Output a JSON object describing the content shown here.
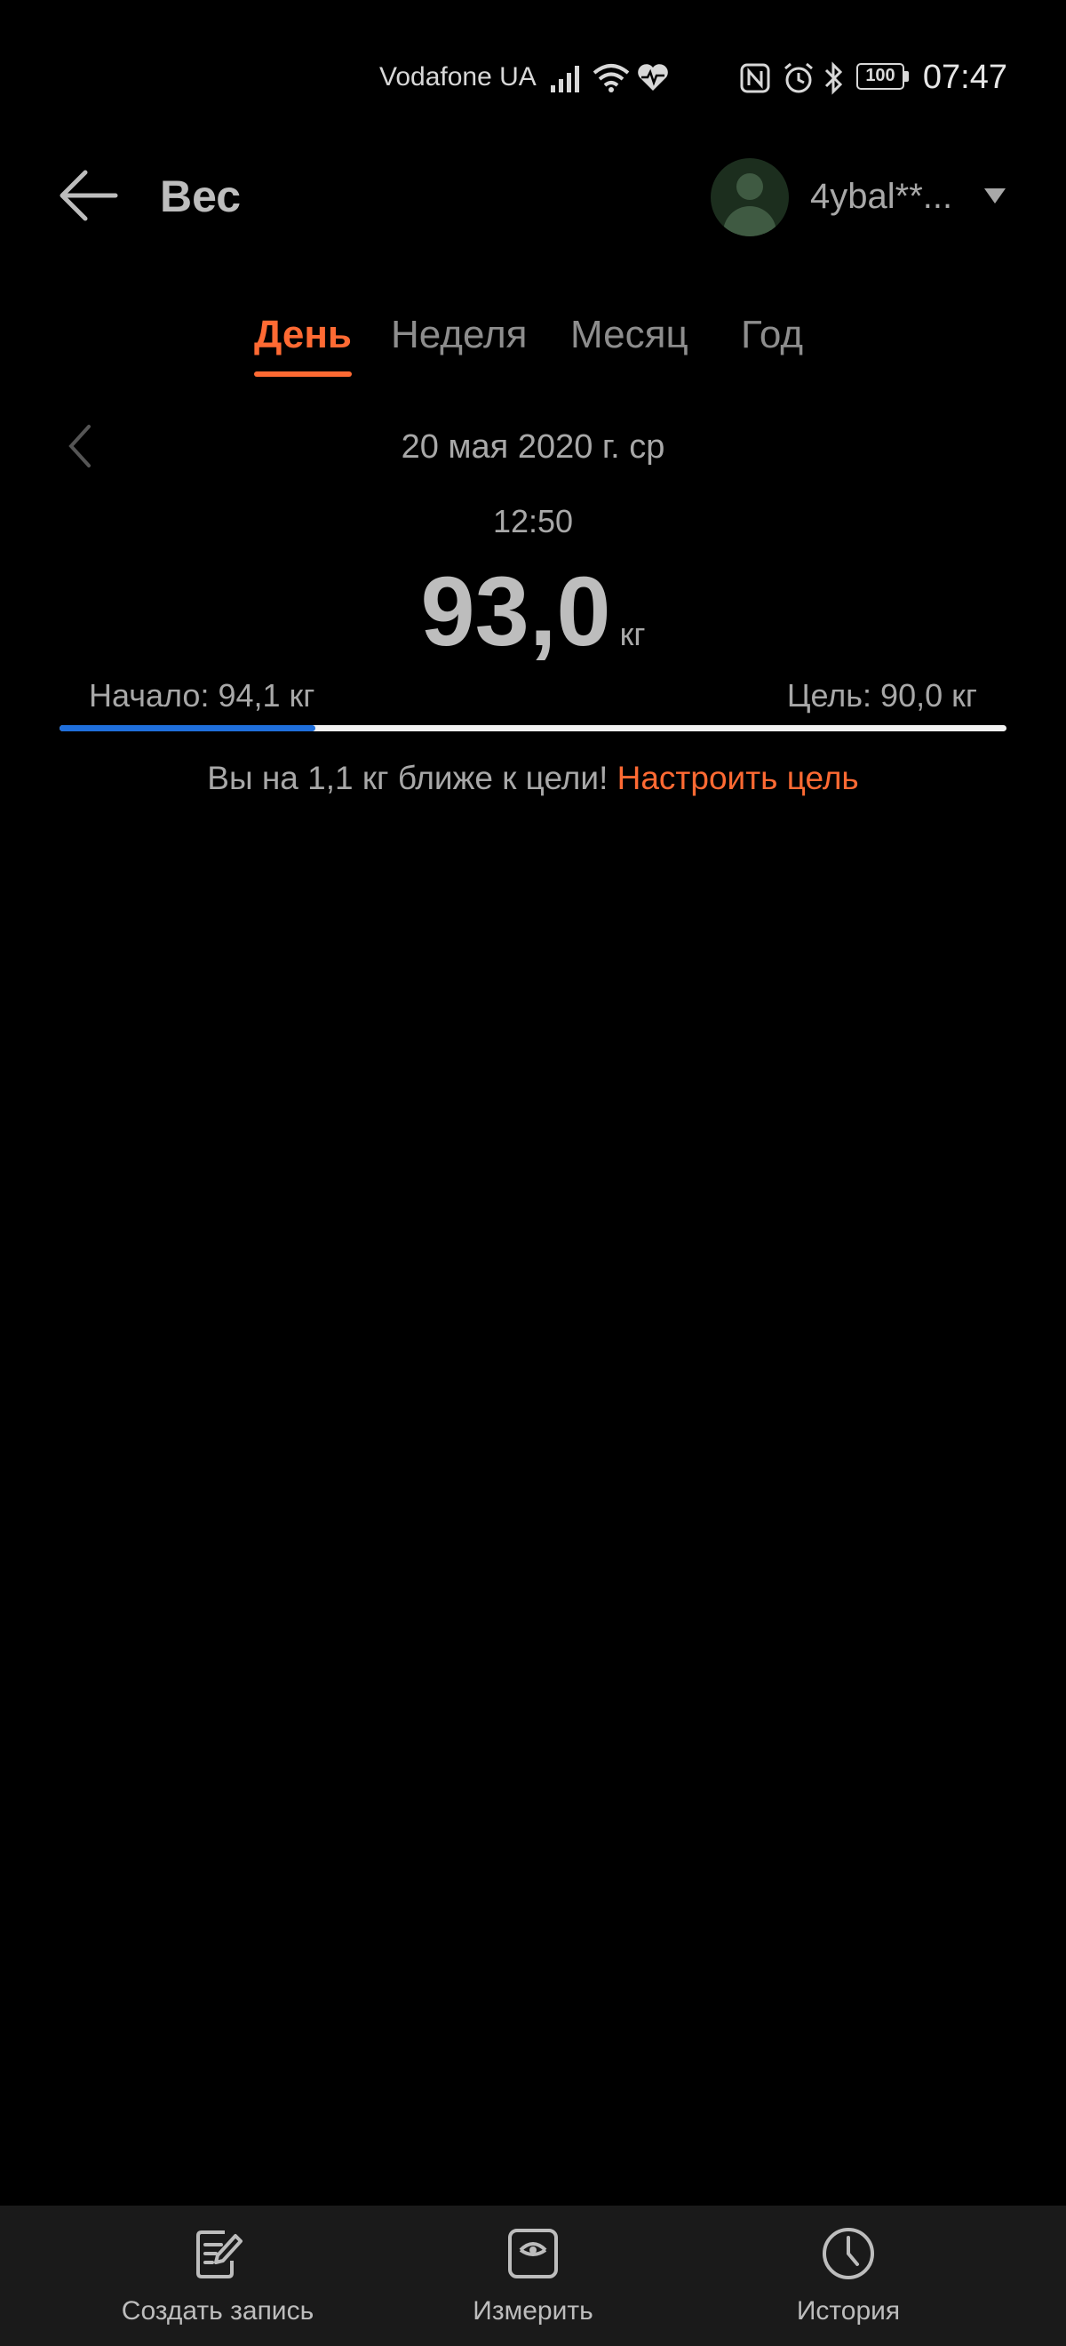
{
  "status_bar": {
    "carrier": "Vodafone UA",
    "battery": "100",
    "time": "07:47"
  },
  "header": {
    "title": "Вес",
    "account_name": "4ybal**..."
  },
  "tabs": [
    {
      "label": "День",
      "active": true
    },
    {
      "label": "Неделя",
      "active": false
    },
    {
      "label": "Месяц",
      "active": false
    },
    {
      "label": "Год",
      "active": false
    }
  ],
  "reading": {
    "date": "20 мая 2020 г. ср",
    "time": "12:50",
    "value": "93,0",
    "unit": "кг"
  },
  "goal": {
    "start_label": "Начало: 94,1 кг",
    "goal_label": "Цель: 90,0 кг",
    "progress_fraction": 0.27,
    "message": "Вы на 1,1 кг ближе к цели!",
    "set_goal_link": "Настроить цель"
  },
  "bottom_nav": [
    {
      "label": "Создать запись",
      "icon": "edit-note-icon"
    },
    {
      "label": "Измерить",
      "icon": "scale-icon"
    },
    {
      "label": "История",
      "icon": "clock-icon"
    }
  ],
  "colors": {
    "accent": "#ff6a33",
    "progress": "#1f6fdc",
    "background": "#000000"
  }
}
